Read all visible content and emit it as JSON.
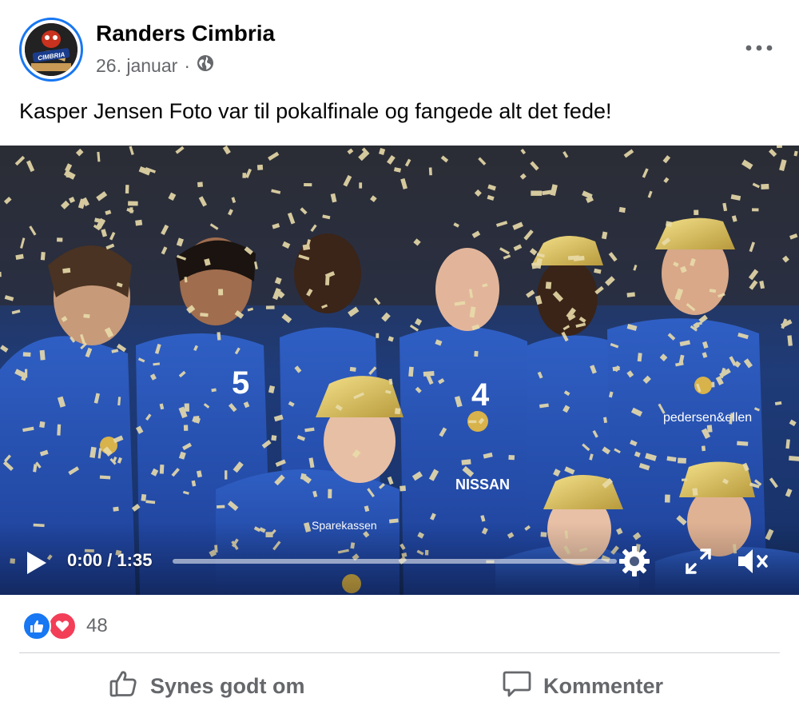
{
  "post": {
    "page_name": "Randers Cimbria",
    "date": "26. januar",
    "separator": "·",
    "audience_icon": "globe-icon",
    "more_icon": "more-horizontal-icon",
    "text": "Kasper Jensen Foto var til pokalfinale og fangede alt det fede!",
    "avatar_logo_text": "CIMBRIA"
  },
  "video": {
    "current_time": "0:00",
    "duration": "1:35",
    "time_separator": " / ",
    "progress": 0,
    "icons": [
      "play-icon",
      "settings-gear-icon",
      "fullscreen-icon",
      "volume-muted-icon"
    ],
    "jersey_texts": [
      "5",
      "4",
      "NISSAN",
      "pedersen&ellen",
      "Sparekassen"
    ]
  },
  "reactions": {
    "types": [
      "like",
      "love"
    ],
    "count": "48"
  },
  "actions": {
    "like_label": "Synes godt om",
    "comment_label": "Kommenter"
  },
  "colors": {
    "accent": "#1877f2",
    "love": "#f33e58",
    "secondary_text": "#65676b",
    "divider": "#ced0d4"
  }
}
